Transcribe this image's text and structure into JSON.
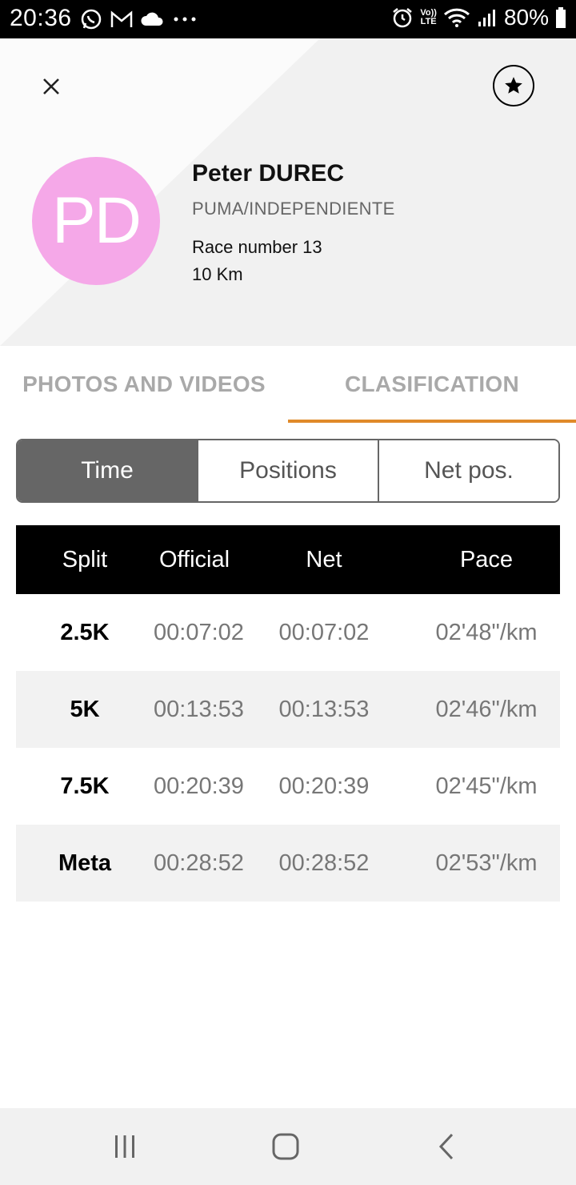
{
  "status_bar": {
    "time": "20:36",
    "battery": "80%",
    "lte_top": "Vo))",
    "lte_bottom": "LTE"
  },
  "header": {
    "avatar_initials": "PD",
    "avatar_color": "#f5a8e8",
    "name": "Peter DUREC",
    "club": "PUMA/INDEPENDIENTE",
    "race_number": "Race number 13",
    "distance": "10 Km"
  },
  "tabs": [
    {
      "label": "PHOTOS AND VIDEOS",
      "active": false
    },
    {
      "label": "CLASIFICATION",
      "active": true
    }
  ],
  "accent_color": "#e08a2a",
  "segments": [
    {
      "label": "Time",
      "active": true
    },
    {
      "label": "Positions",
      "active": false
    },
    {
      "label": "Net pos.",
      "active": false
    }
  ],
  "table": {
    "headers": [
      "Split",
      "Official",
      "Net",
      "Pace"
    ],
    "rows": [
      {
        "split": "2.5K",
        "official": "00:07:02",
        "net": "00:07:02",
        "pace": "02'48\"/km"
      },
      {
        "split": "5K",
        "official": "00:13:53",
        "net": "00:13:53",
        "pace": "02'46\"/km"
      },
      {
        "split": "7.5K",
        "official": "00:20:39",
        "net": "00:20:39",
        "pace": "02'45\"/km"
      },
      {
        "split": "Meta",
        "official": "00:28:52",
        "net": "00:28:52",
        "pace": "02'53\"/km"
      }
    ]
  },
  "icons": {
    "close": "close-icon",
    "favorite": "star-icon",
    "nav_recents": "recents-icon",
    "nav_home": "home-icon",
    "nav_back": "back-icon"
  }
}
